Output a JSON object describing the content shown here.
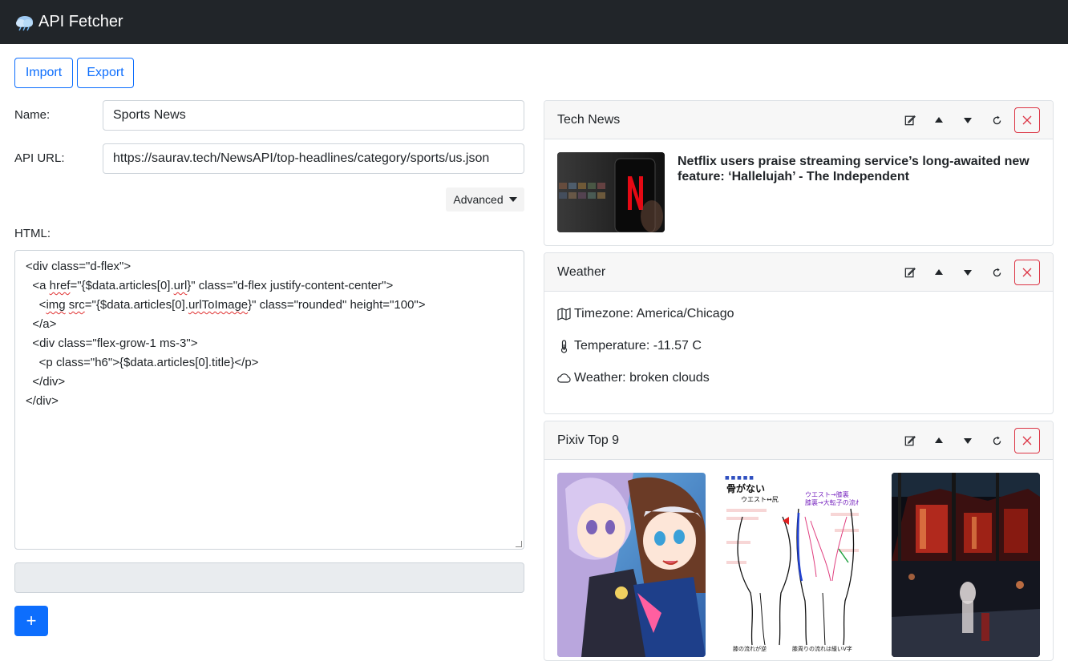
{
  "app": {
    "title": "API Fetcher"
  },
  "toolbar": {
    "import_label": "Import",
    "export_label": "Export"
  },
  "form": {
    "name_label": "Name:",
    "name_value": "Sports News",
    "url_label": "API URL:",
    "url_value": "https://saurav.tech/NewsAPI/top-headlines/category/sports/us.json",
    "advanced_label": "Advanced",
    "html_label": "HTML:",
    "add_label": "+"
  },
  "code": {
    "l1": "<div class=\"d-flex\">",
    "l2a": "  <a ",
    "l2b": "href",
    "l2c": "=\"{$data.articles[0].",
    "l2d": "url",
    "l2e": "}\" class=\"d-flex justify-content-center\">",
    "l3a": "    <",
    "l3b": "img",
    "l3c": " ",
    "l3d": "src",
    "l3e": "=\"{$data.articles[0].",
    "l3f": "urlToImage",
    "l3g": "}\" class=\"rounded\" height=\"100\">",
    "l4": "  </a>",
    "l5": "  <div class=\"flex-grow-1 ms-3\">",
    "l6": "    <p class=\"h6\">{$data.articles[0].title}</p>",
    "l7": "  </div>",
    "l8": "</div>"
  },
  "cards": {
    "tech": {
      "title": "Tech News",
      "headline": "Netflix users praise streaming service’s long-awaited new feature: ‘Hallelujah’ - The Independent"
    },
    "weather": {
      "title": "Weather",
      "timezone": "Timezone: America/Chicago",
      "temperature": "Temperature: -11.57 C",
      "weather": "Weather: broken clouds"
    },
    "pixiv": {
      "title": "Pixiv Top 9",
      "image2_text_top": "骨がない",
      "image2_text_sub": "ウエスト↔尻",
      "image2_text_right1": "ウエスト→膝裏",
      "image2_text_right2": "膝裏→大転子の流れ",
      "image2_text_bottom1": "膝の流れが逆",
      "image2_text_bottom2": "膝周りの流れは緩いV字"
    }
  },
  "colors": {
    "primary": "#0d6efd",
    "danger": "#dc3545",
    "navbar": "#212529"
  }
}
